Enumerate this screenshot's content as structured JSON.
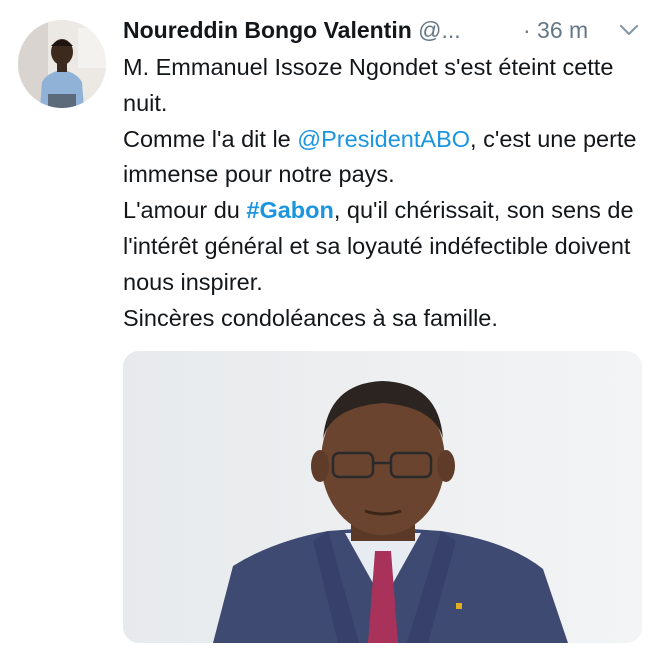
{
  "tweet": {
    "author_name": "Noureddin Bongo Valentin",
    "handle": "@...",
    "time": "· 36 m",
    "lines": {
      "l1": "M. Emmanuel Issoze Ngondet s'est éteint cette nuit.",
      "l2_pre": "Comme l'a dit le ",
      "l2_mention": "@PresidentABO",
      "l2_post": ", c'est une perte immense pour notre pays.",
      "l3_pre": "L'amour du ",
      "l3_hashtag": "#Gabon",
      "l3_post": ", qu'il chérissait, son sens de l'intérêt général et sa loyauté indéfectible doivent nous inspirer.",
      "l4": "Sincères condoléances à sa famille."
    }
  },
  "icons": {
    "avatar": "profile-photo",
    "menu": "chevron-down-icon"
  },
  "colors": {
    "link": "#1b95e0",
    "muted": "#657786",
    "text": "#14171a"
  }
}
